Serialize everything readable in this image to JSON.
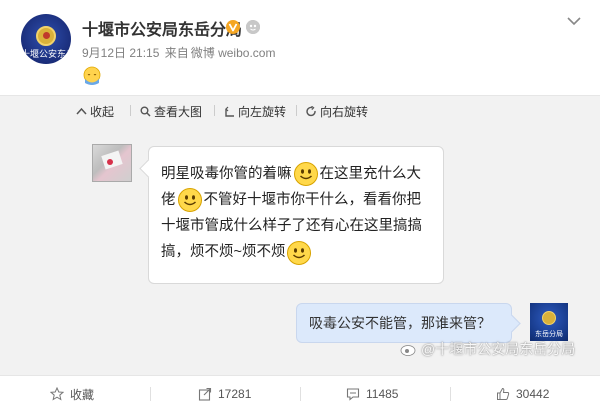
{
  "post": {
    "author": "十堰市公安局东岳分局",
    "verified_icon": "verified-v-icon",
    "date": "9月12日 21:15",
    "source_prefix": "来自",
    "source": "微博 weibo.com",
    "avatar_caption": "十堰公安东岳",
    "emoji": "facepalm-emoji"
  },
  "toolbar": {
    "collapse": "收起",
    "view_large": "查看大图",
    "rotate_left": "向左旋转",
    "rotate_right": "向右旋转"
  },
  "chat": {
    "left_message_parts": [
      "明星吸毒你管的着嘛",
      "在这里充什么大佬",
      "不管好十堰市你干什么，看看你把十堰市管成什么样子了还有心在这里搞搞搞，烦不烦~烦不烦"
    ],
    "right_message": "吸毒公安不能管，那谁来管？",
    "chat_avatar_caption": "东岳分局",
    "watermark": "@十堰市公安局东岳分局"
  },
  "actions": {
    "favorite": "收藏",
    "repost": "17281",
    "comment": "11485",
    "like": "30442"
  },
  "colors": {
    "verified": "#f5a623",
    "bubble_right": "#dce9fb",
    "link_blue": "#1e6bd6"
  }
}
